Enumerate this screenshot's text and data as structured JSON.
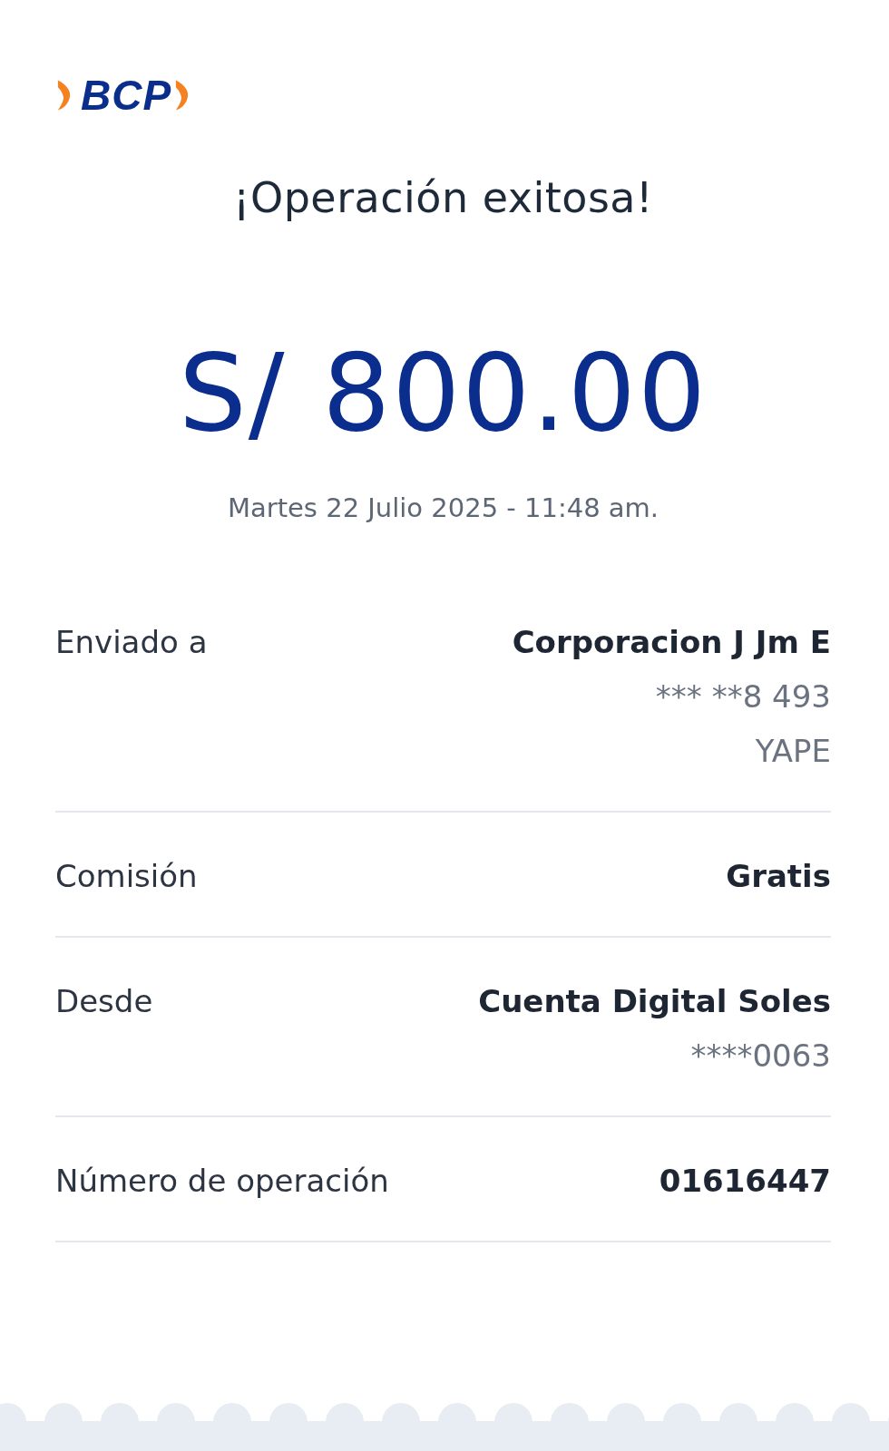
{
  "logo": {
    "text": "BCP"
  },
  "title": "¡Operación exitosa!",
  "amount": "S/ 800.00",
  "datetime": "Martes 22 Julio 2025 - 11:48 am.",
  "details": [
    {
      "label": "Enviado a",
      "values": [
        {
          "text": "Corporacion J Jm E",
          "kind": "primary"
        },
        {
          "text": "*** **8 493",
          "kind": "secondary"
        },
        {
          "text": "YAPE",
          "kind": "secondary"
        }
      ]
    },
    {
      "label": "Comisión",
      "values": [
        {
          "text": "Gratis",
          "kind": "primary"
        }
      ]
    },
    {
      "label": "Desde",
      "values": [
        {
          "text": "Cuenta Digital Soles",
          "kind": "primary"
        },
        {
          "text": "****0063",
          "kind": "secondary"
        }
      ]
    },
    {
      "label": "Número de operación",
      "values": [
        {
          "text": "01616447",
          "kind": "primary"
        }
      ]
    }
  ]
}
